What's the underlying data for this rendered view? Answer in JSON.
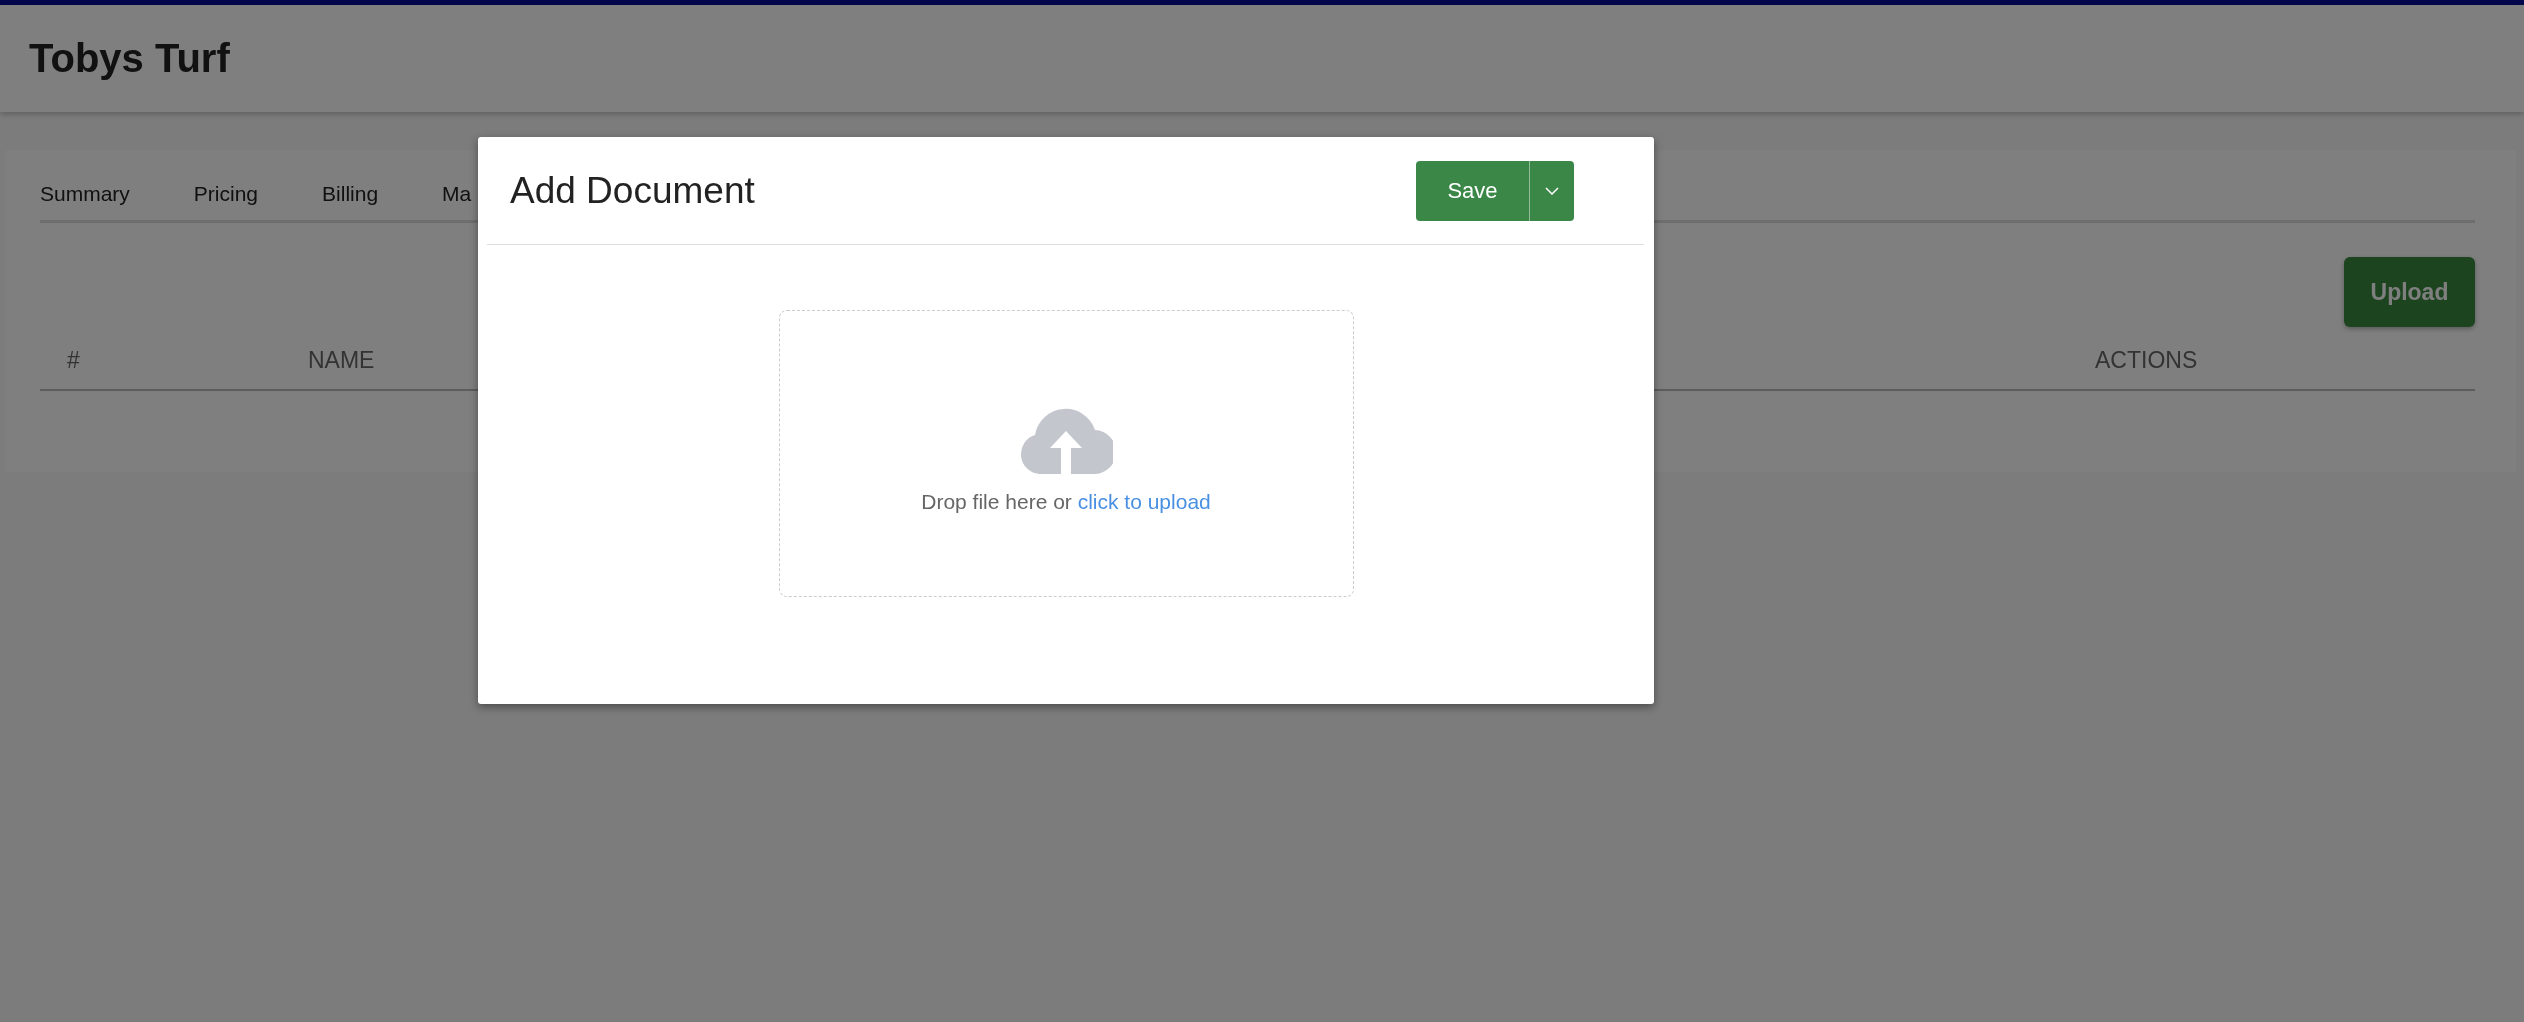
{
  "app": {
    "title": "Tobys Turf"
  },
  "tabs": [
    {
      "label": "Summary"
    },
    {
      "label": "Pricing"
    },
    {
      "label": "Billing"
    },
    {
      "label": "Ma"
    }
  ],
  "upload_button": "Upload",
  "table": {
    "columns": [
      "#",
      "NAME",
      "ACTIONS"
    ]
  },
  "dialog": {
    "title": "Add Document",
    "save_button": "Save",
    "dropzone": {
      "text": "Drop file here or",
      "link": "click to upload"
    }
  }
}
